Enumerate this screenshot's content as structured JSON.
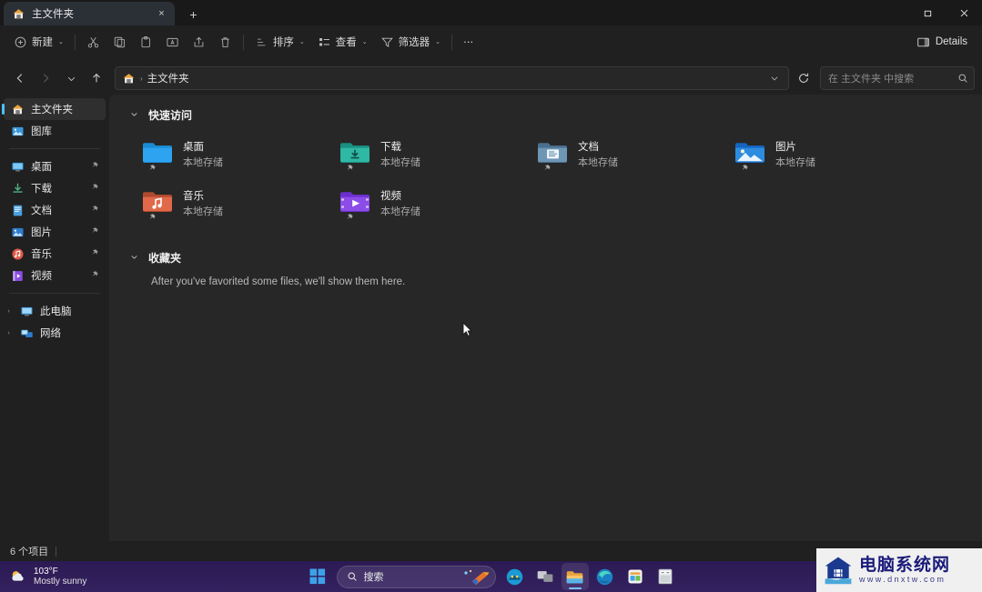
{
  "window": {
    "tab": {
      "label": "主文件夹",
      "icon": "home-icon",
      "close_label": "×"
    },
    "new_tab_label": "+",
    "controls": {
      "maximize": "❐",
      "close": "✕"
    }
  },
  "toolbar": {
    "new_label": "新建",
    "new_caret": "⌄",
    "cut_name": "cut-icon",
    "copy_name": "copy-icon",
    "paste_name": "paste-icon",
    "rename_name": "rename-icon",
    "share_name": "share-icon",
    "delete_name": "delete-icon",
    "sort_label": "排序",
    "view_label": "查看",
    "filter_label": "筛选器",
    "overflow_label": "⋯",
    "details_label": "Details"
  },
  "nav": {
    "back": "←",
    "forward": "→",
    "recent": "⌄",
    "up": "↑",
    "breadcrumb_home_icon": "home-icon",
    "breadcrumb_sep": "›",
    "breadcrumb_text": "主文件夹",
    "dropdown": "⌄",
    "refresh": "⟳"
  },
  "search": {
    "placeholder": "在 主文件夹 中搜索",
    "icon": "search-icon"
  },
  "sidebar": {
    "top": [
      {
        "label": "主文件夹",
        "icon": "home-icon",
        "selected": true,
        "pinned": false
      },
      {
        "label": "图库",
        "icon": "gallery-icon",
        "selected": false,
        "pinned": false
      }
    ],
    "pinned": [
      {
        "label": "桌面",
        "icon": "desktop-icon",
        "pin": "📌"
      },
      {
        "label": "下载",
        "icon": "downloads-icon",
        "pin": "📌"
      },
      {
        "label": "文档",
        "icon": "documents-icon",
        "pin": "📌"
      },
      {
        "label": "图片",
        "icon": "pictures-icon",
        "pin": "📌"
      },
      {
        "label": "音乐",
        "icon": "music-icon",
        "pin": "📌"
      },
      {
        "label": "视频",
        "icon": "videos-icon",
        "pin": "📌"
      }
    ],
    "tree": [
      {
        "label": "此电脑",
        "icon": "this-pc-icon",
        "chevron": "›"
      },
      {
        "label": "网络",
        "icon": "network-icon",
        "chevron": "›"
      }
    ]
  },
  "main": {
    "quick_access": {
      "title": "快速访问",
      "chevron": "⌄",
      "items": [
        {
          "name": "桌面",
          "sub": "本地存储",
          "icon": "folder-desktop",
          "pin": "📌"
        },
        {
          "name": "下载",
          "sub": "本地存储",
          "icon": "folder-downloads",
          "pin": "📌"
        },
        {
          "name": "文档",
          "sub": "本地存储",
          "icon": "folder-documents",
          "pin": "📌"
        },
        {
          "name": "图片",
          "sub": "本地存储",
          "icon": "folder-pictures",
          "pin": "📌"
        },
        {
          "name": "音乐",
          "sub": "本地存储",
          "icon": "folder-music",
          "pin": "📌"
        },
        {
          "name": "视频",
          "sub": "本地存储",
          "icon": "folder-videos",
          "pin": "📌"
        }
      ]
    },
    "favorites": {
      "title": "收藏夹",
      "chevron": "⌄",
      "empty_text": "After you've favorited some files, we'll show them here."
    }
  },
  "status": {
    "item_count": "6 个项目"
  },
  "taskbar": {
    "weather": {
      "temp": "103°F",
      "condition": "Mostly sunny"
    },
    "start_name": "windows-start-icon",
    "search_label": "搜索",
    "search_icon": "search-icon",
    "items": [
      {
        "name": "copilot-icon"
      },
      {
        "name": "task-view-icon"
      },
      {
        "name": "file-explorer-icon",
        "active": true
      },
      {
        "name": "edge-icon"
      },
      {
        "name": "microsoft-store-icon"
      },
      {
        "name": "calculator-icon"
      }
    ]
  },
  "watermark": {
    "title": "电脑系统网",
    "url": "www.dnxtw.com"
  },
  "colors": {
    "accent": "#4cc2ff",
    "window_bg": "#202020",
    "content_bg": "#272727",
    "taskbar": "#34215f"
  }
}
